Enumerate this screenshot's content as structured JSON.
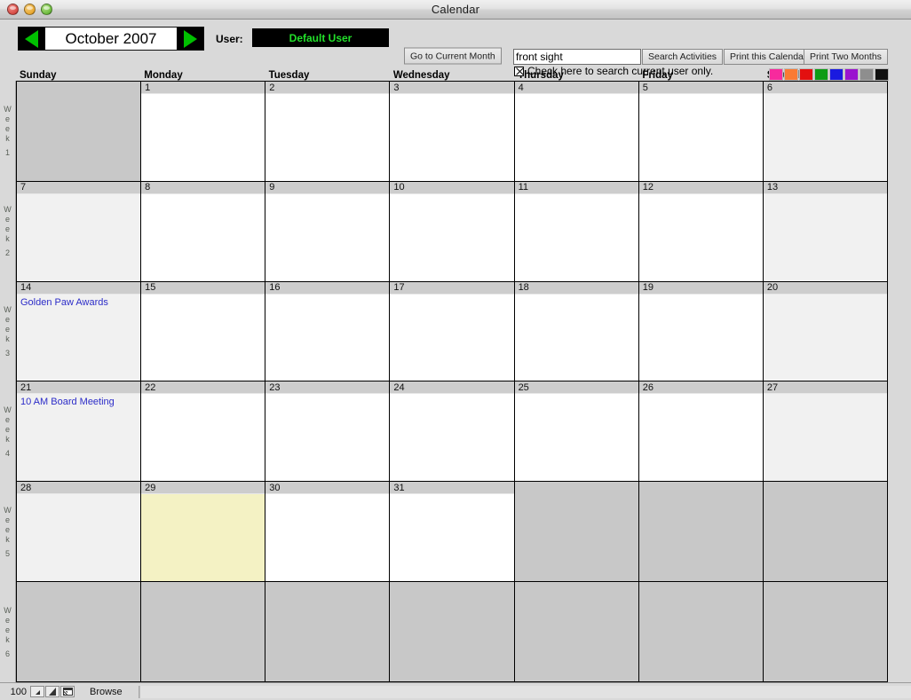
{
  "window": {
    "title": "Calendar",
    "controls": [
      "close",
      "minimize",
      "maximize"
    ]
  },
  "toolbar": {
    "month_label": "October 2007",
    "prev_month_icon": "triangle-left-icon",
    "next_month_icon": "triangle-right-icon",
    "user_label": "User:",
    "user_value": "Default User",
    "goto_current_label": "Go to Current Month",
    "search_value": "front sight",
    "search_placeholder": "",
    "search_button_label": "Search Activities",
    "print_calendar_label": "Print this Calendar",
    "print_two_months_label": "Print Two Months",
    "checkbox_label": "Check here to search current user only.",
    "checkbox_checked": true,
    "swatches": [
      "#f72a9d",
      "#fa7a33",
      "#e31010",
      "#0c9c14",
      "#1a1ae0",
      "#9a13cf",
      "#8e8e8e",
      "#101010"
    ]
  },
  "calendar": {
    "day_headers": [
      "Sunday",
      "Monday",
      "Tuesday",
      "Wednesday",
      "Thursday",
      "Friday",
      "Saturday"
    ],
    "week_label_text": "Week",
    "weeks": [
      {
        "label": "Week",
        "number": "1",
        "days": [
          {
            "date": "",
            "active": false,
            "weekend": true,
            "today": false,
            "events": []
          },
          {
            "date": "1",
            "active": true,
            "weekend": false,
            "today": false,
            "events": []
          },
          {
            "date": "2",
            "active": true,
            "weekend": false,
            "today": false,
            "events": []
          },
          {
            "date": "3",
            "active": true,
            "weekend": false,
            "today": false,
            "events": []
          },
          {
            "date": "4",
            "active": true,
            "weekend": false,
            "today": false,
            "events": []
          },
          {
            "date": "5",
            "active": true,
            "weekend": false,
            "today": false,
            "events": []
          },
          {
            "date": "6",
            "active": true,
            "weekend": true,
            "today": false,
            "events": []
          }
        ]
      },
      {
        "label": "Week",
        "number": "2",
        "days": [
          {
            "date": "7",
            "active": true,
            "weekend": true,
            "today": false,
            "events": []
          },
          {
            "date": "8",
            "active": true,
            "weekend": false,
            "today": false,
            "events": []
          },
          {
            "date": "9",
            "active": true,
            "weekend": false,
            "today": false,
            "events": []
          },
          {
            "date": "10",
            "active": true,
            "weekend": false,
            "today": false,
            "events": []
          },
          {
            "date": "11",
            "active": true,
            "weekend": false,
            "today": false,
            "events": []
          },
          {
            "date": "12",
            "active": true,
            "weekend": false,
            "today": false,
            "events": []
          },
          {
            "date": "13",
            "active": true,
            "weekend": true,
            "today": false,
            "events": []
          }
        ]
      },
      {
        "label": "Week",
        "number": "3",
        "days": [
          {
            "date": "14",
            "active": true,
            "weekend": true,
            "today": false,
            "events": [
              "Golden Paw Awards"
            ]
          },
          {
            "date": "15",
            "active": true,
            "weekend": false,
            "today": false,
            "events": []
          },
          {
            "date": "16",
            "active": true,
            "weekend": false,
            "today": false,
            "events": []
          },
          {
            "date": "17",
            "active": true,
            "weekend": false,
            "today": false,
            "events": []
          },
          {
            "date": "18",
            "active": true,
            "weekend": false,
            "today": false,
            "events": []
          },
          {
            "date": "19",
            "active": true,
            "weekend": false,
            "today": false,
            "events": []
          },
          {
            "date": "20",
            "active": true,
            "weekend": true,
            "today": false,
            "events": []
          }
        ]
      },
      {
        "label": "Week",
        "number": "4",
        "days": [
          {
            "date": "21",
            "active": true,
            "weekend": true,
            "today": false,
            "events": [
              "10 AM Board Meeting"
            ]
          },
          {
            "date": "22",
            "active": true,
            "weekend": false,
            "today": false,
            "events": []
          },
          {
            "date": "23",
            "active": true,
            "weekend": false,
            "today": false,
            "events": []
          },
          {
            "date": "24",
            "active": true,
            "weekend": false,
            "today": false,
            "events": []
          },
          {
            "date": "25",
            "active": true,
            "weekend": false,
            "today": false,
            "events": []
          },
          {
            "date": "26",
            "active": true,
            "weekend": false,
            "today": false,
            "events": []
          },
          {
            "date": "27",
            "active": true,
            "weekend": true,
            "today": false,
            "events": []
          }
        ]
      },
      {
        "label": "Week",
        "number": "5",
        "days": [
          {
            "date": "28",
            "active": true,
            "weekend": true,
            "today": false,
            "events": []
          },
          {
            "date": "29",
            "active": true,
            "weekend": false,
            "today": true,
            "events": []
          },
          {
            "date": "30",
            "active": true,
            "weekend": false,
            "today": false,
            "events": []
          },
          {
            "date": "31",
            "active": true,
            "weekend": false,
            "today": false,
            "events": []
          },
          {
            "date": "",
            "active": false,
            "weekend": false,
            "today": false,
            "events": []
          },
          {
            "date": "",
            "active": false,
            "weekend": false,
            "today": false,
            "events": []
          },
          {
            "date": "",
            "active": false,
            "weekend": true,
            "today": false,
            "events": []
          }
        ]
      },
      {
        "label": "Week",
        "number": "6",
        "days": [
          {
            "date": "",
            "active": false,
            "weekend": true,
            "today": false,
            "events": []
          },
          {
            "date": "",
            "active": false,
            "weekend": false,
            "today": false,
            "events": []
          },
          {
            "date": "",
            "active": false,
            "weekend": false,
            "today": false,
            "events": []
          },
          {
            "date": "",
            "active": false,
            "weekend": false,
            "today": false,
            "events": []
          },
          {
            "date": "",
            "active": false,
            "weekend": false,
            "today": false,
            "events": []
          },
          {
            "date": "",
            "active": false,
            "weekend": false,
            "today": false,
            "events": []
          },
          {
            "date": "",
            "active": false,
            "weekend": true,
            "today": false,
            "events": []
          }
        ]
      }
    ]
  },
  "statusbar": {
    "zoom_level": "100",
    "zoom_out_icon": "zoom-out-icon",
    "zoom_in_icon": "zoom-in-icon",
    "layout_toggle_icon": "window-layout-icon",
    "mode_label": "Browse"
  }
}
